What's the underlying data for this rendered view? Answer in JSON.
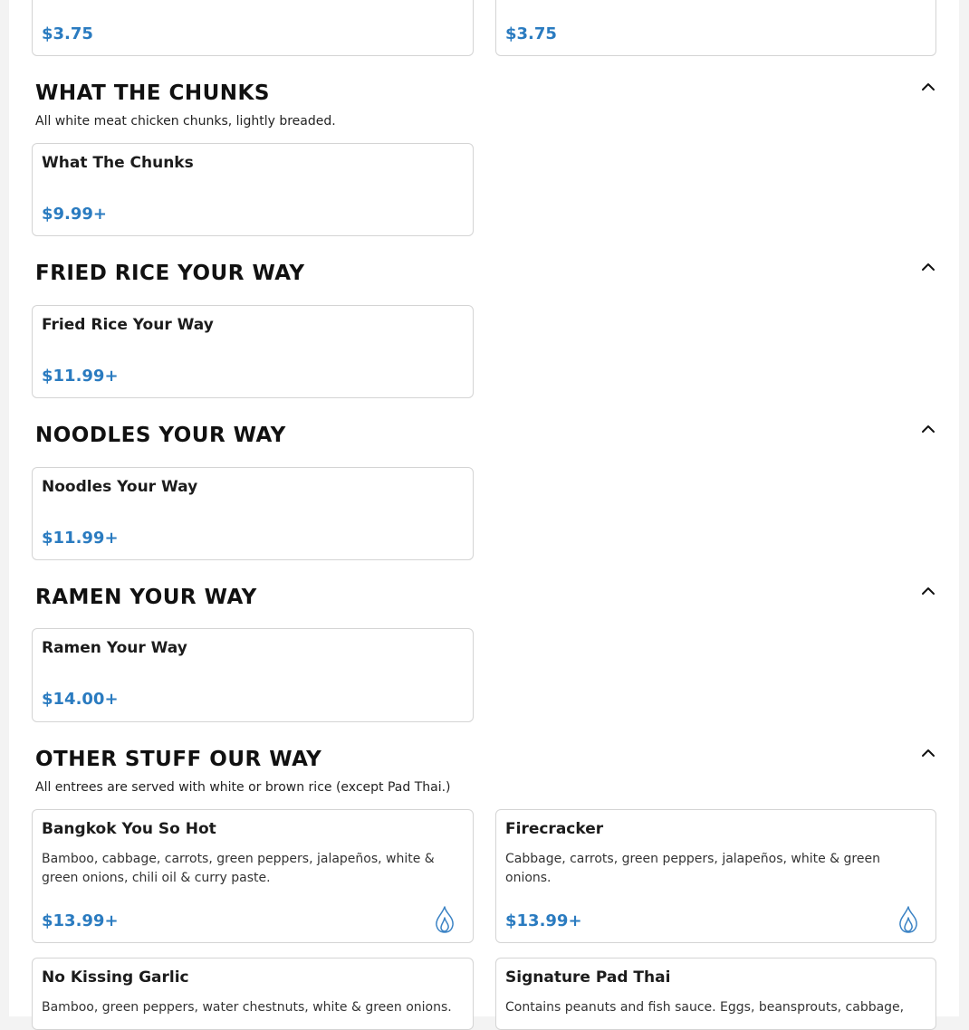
{
  "top_cards": [
    {
      "price": "$3.75"
    },
    {
      "price": "$3.75"
    }
  ],
  "sections": [
    {
      "title": "WHAT THE CHUNKS",
      "description": "All white meat chicken chunks, lightly breaded.",
      "items": [
        {
          "name": "What The Chunks",
          "price": "$9.99+"
        }
      ]
    },
    {
      "title": "FRIED RICE YOUR WAY",
      "items": [
        {
          "name": "Fried Rice Your Way",
          "price": "$11.99+"
        }
      ]
    },
    {
      "title": "NOODLES YOUR WAY",
      "items": [
        {
          "name": "Noodles Your Way",
          "price": "$11.99+"
        }
      ]
    },
    {
      "title": "RAMEN YOUR WAY",
      "items": [
        {
          "name": "Ramen Your Way",
          "price": "$14.00+"
        }
      ]
    },
    {
      "title": "OTHER STUFF OUR WAY",
      "description": "All entrees are served with white or brown rice (except Pad Thai.)",
      "items": [
        {
          "name": "Bangkok You So Hot",
          "description": "Bamboo, cabbage, carrots, green peppers, jalapeños, white & green onions, chili oil & curry paste.",
          "price": "$13.99+",
          "icon": "spicy-flame-icon"
        },
        {
          "name": "Firecracker",
          "description": "Cabbage, carrots, green peppers, jalapeños, white & green onions.",
          "price": "$13.99+",
          "icon": "spicy-flame-icon"
        },
        {
          "name": "No Kissing Garlic",
          "description": "Bamboo, green peppers, water chestnuts, white & green onions."
        },
        {
          "name": "Signature Pad Thai",
          "description": "Contains peanuts and fish sauce. Eggs, beansprouts, cabbage,"
        }
      ]
    }
  ],
  "icons": {
    "collapse": "chevron-up-icon",
    "spicy": "spicy-flame-icon"
  },
  "colors": {
    "price": "#2a7bc0",
    "flame": "#3a82c4",
    "card_border": "#d4d4d4"
  }
}
